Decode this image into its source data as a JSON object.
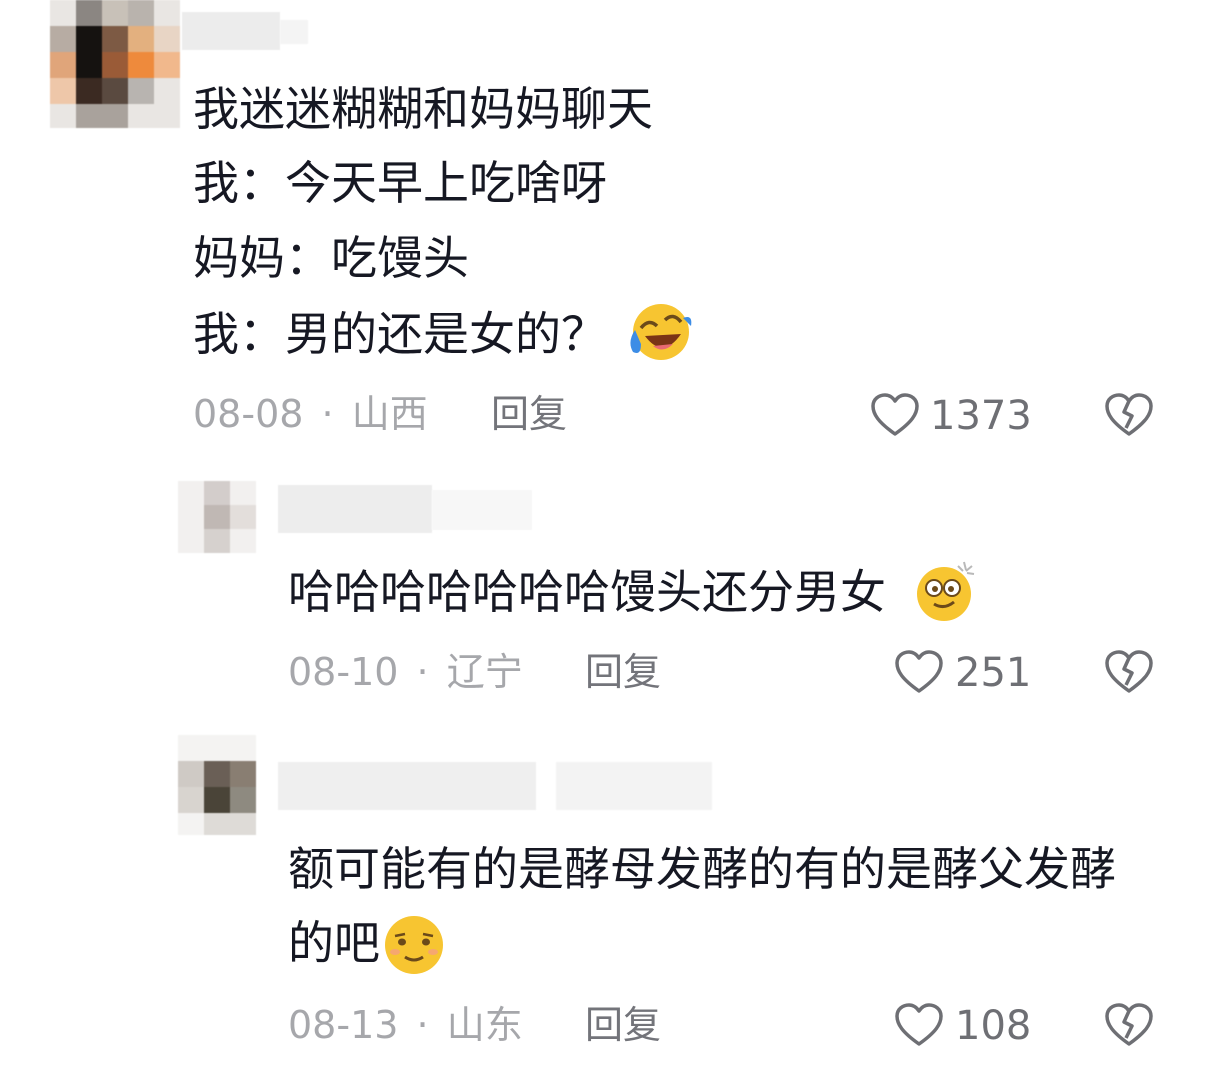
{
  "comments": [
    {
      "lines": [
        "我迷迷糊糊和妈妈聊天",
        "我：今天早上吃啥呀",
        "妈妈：吃馒头",
        "我：男的还是女的？"
      ],
      "emoji": "laughing-crying-emoji",
      "date": "08-08",
      "sep": "·",
      "location": "山西",
      "reply": "回复",
      "likes": "1373"
    },
    {
      "lines": [
        "哈哈哈哈哈哈哈馒头还分男女"
      ],
      "emoji": "dizzy-face-emoji",
      "date": "08-10",
      "sep": "·",
      "location": "辽宁",
      "reply": "回复",
      "likes": "251"
    },
    {
      "lines": [
        "额可能有的是酵母发酵的有的是酵父发酵",
        "的吧"
      ],
      "emoji": "smug-face-emoji",
      "date": "08-13",
      "sep": "·",
      "location": "山东",
      "reply": "回复",
      "likes": "108"
    }
  ],
  "colors": {
    "text": "#161823",
    "meta": "#a6a7ab",
    "icon": "#6e6f74"
  },
  "icons": {
    "like": "heart-outline-icon",
    "dislike": "broken-heart-icon"
  }
}
